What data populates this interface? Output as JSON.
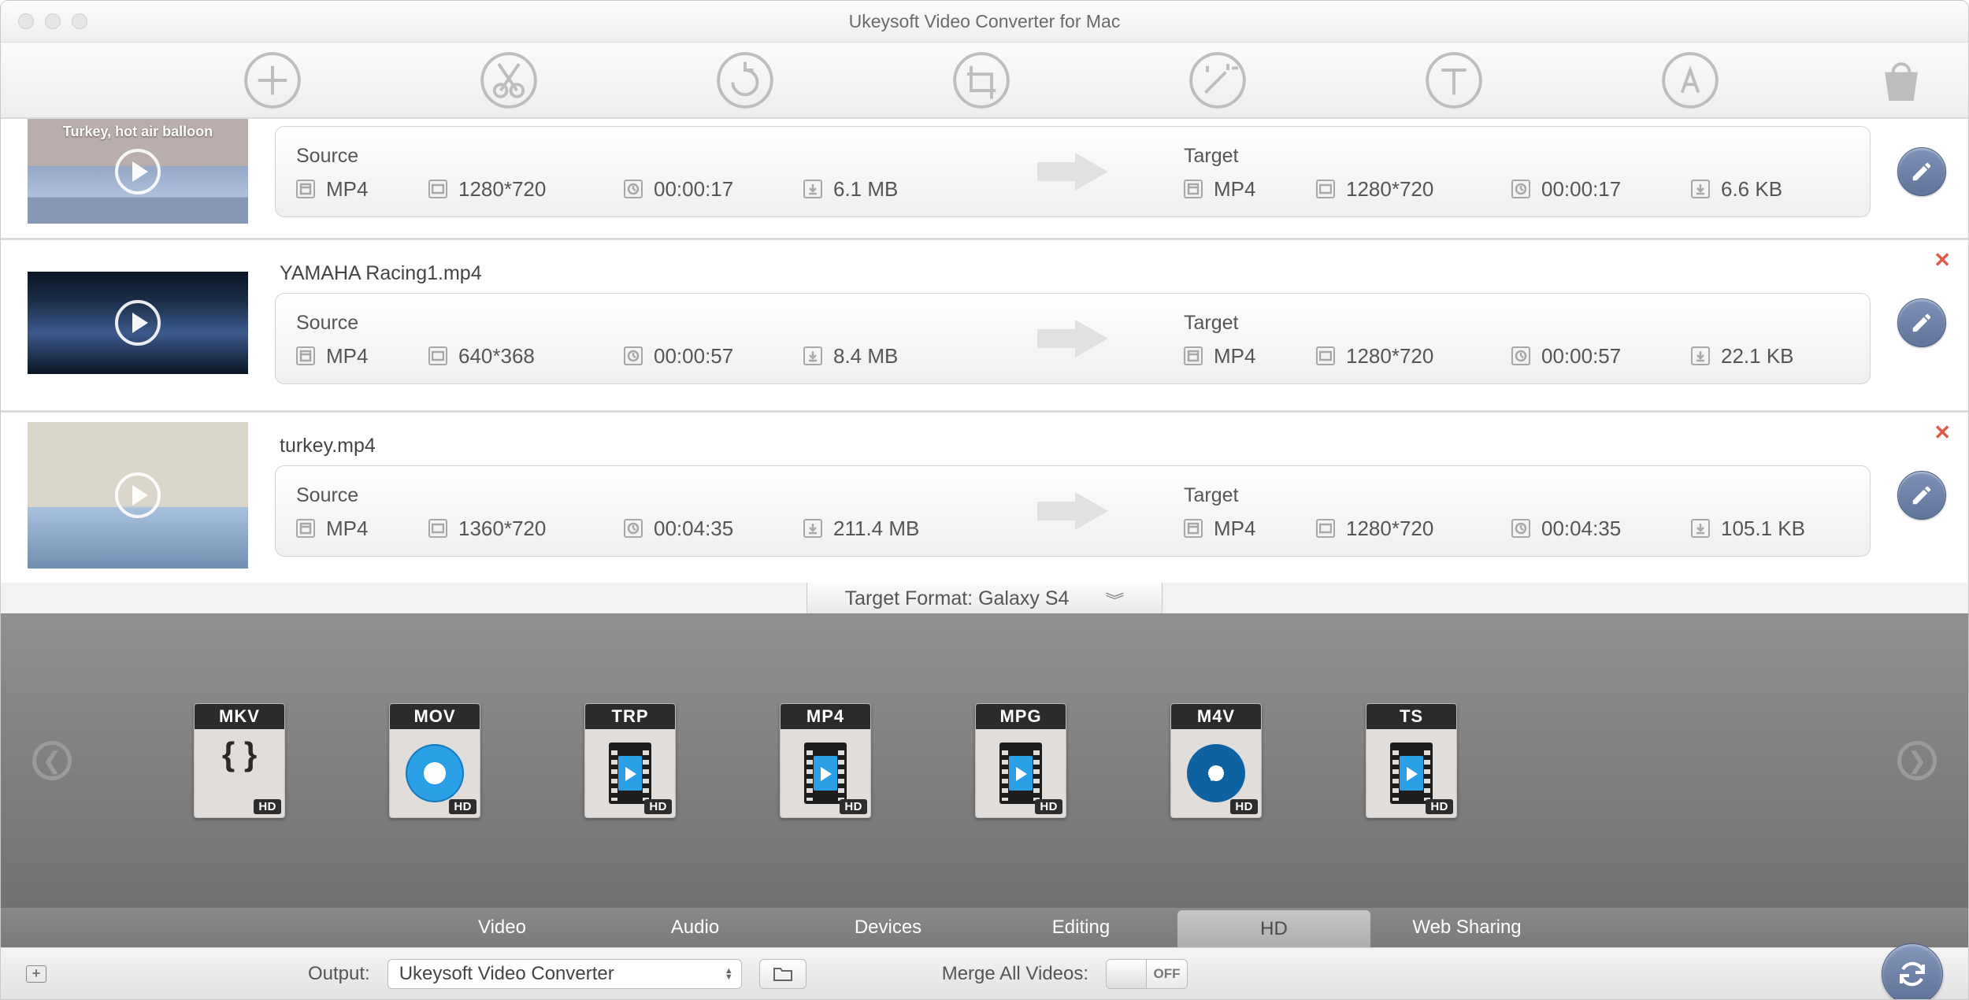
{
  "window": {
    "title": "Ukeysoft Video Converter for Mac"
  },
  "toolbar_icons": [
    "add",
    "trim",
    "rotate",
    "crop",
    "effect",
    "text-watermark",
    "image-watermark",
    "buy"
  ],
  "labels": {
    "source": "Source",
    "target": "Target",
    "target_format_prefix": "Target Format:",
    "output": "Output:",
    "merge": "Merge All Videos:",
    "toggle_off": "OFF",
    "hd_badge": "HD"
  },
  "videos": [
    {
      "filename": "",
      "thumb_label": "Turkey, hot air balloon",
      "source": {
        "format": "MP4",
        "resolution": "1280*720",
        "duration": "00:00:17",
        "size": "6.1 MB"
      },
      "target": {
        "format": "MP4",
        "resolution": "1280*720",
        "duration": "00:00:17",
        "size": "6.6 KB"
      },
      "show_close": false
    },
    {
      "filename": "YAMAHA Racing1.mp4",
      "thumb_label": "",
      "source": {
        "format": "MP4",
        "resolution": "640*368",
        "duration": "00:00:57",
        "size": "8.4 MB"
      },
      "target": {
        "format": "MP4",
        "resolution": "1280*720",
        "duration": "00:00:57",
        "size": "22.1 KB"
      },
      "show_close": true
    },
    {
      "filename": "turkey.mp4",
      "thumb_label": "",
      "source": {
        "format": "MP4",
        "resolution": "1360*720",
        "duration": "00:04:35",
        "size": "211.4 MB"
      },
      "target": {
        "format": "MP4",
        "resolution": "1280*720",
        "duration": "00:04:35",
        "size": "105.1 KB"
      },
      "show_close": true
    }
  ],
  "target_format": "Galaxy S4",
  "formats": [
    "MKV",
    "MOV",
    "TRP",
    "MP4",
    "MPG",
    "M4V",
    "TS"
  ],
  "tabs": [
    "Video",
    "Audio",
    "Devices",
    "Editing",
    "HD",
    "Web Sharing"
  ],
  "active_tab": "HD",
  "output_folder": "Ukeysoft Video Converter",
  "merge_state": "OFF"
}
